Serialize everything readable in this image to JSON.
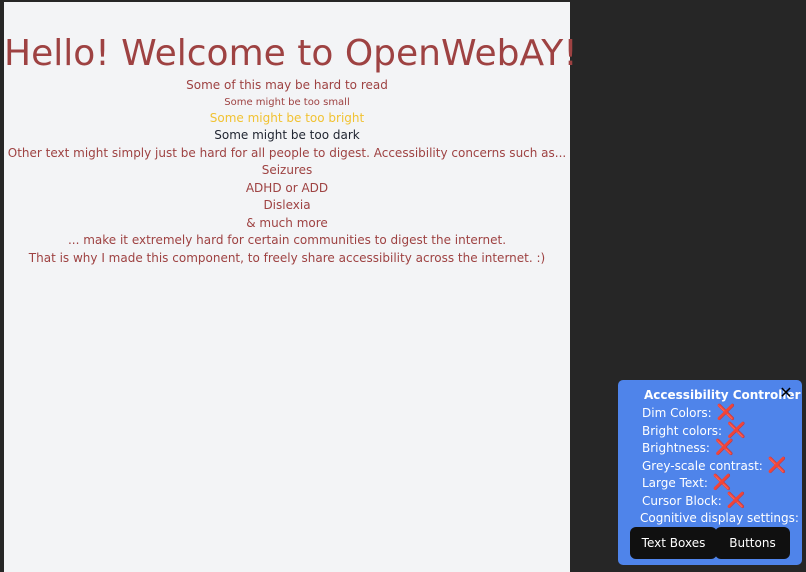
{
  "main": {
    "title": "Hello! Welcome to OpenWebAY!",
    "lines": [
      "Some of this may be hard to read",
      "Some might be too small",
      "Some might be too bright",
      "Some might be too dark",
      "Other text might simply just be hard for all people to digest. Accessibility concerns such as...",
      "Seizures",
      "ADHD or ADD",
      "Dislexia",
      "& much more",
      "... make it extremely hard for certain communities to digest the internet.",
      "That is why I made this component, to freely share accessibility across the internet. :)"
    ]
  },
  "controller": {
    "title": "Accessibility Controller",
    "close_glyph": "✕",
    "options": [
      {
        "label": "Dim Colors:",
        "state_icon": "cross-icon",
        "glyph": "❌"
      },
      {
        "label": "Bright colors:",
        "state_icon": "cross-icon",
        "glyph": "❌"
      },
      {
        "label": "Brightness:",
        "state_icon": "cross-icon",
        "glyph": "❌"
      },
      {
        "label": "Grey-scale contrast:",
        "state_icon": "cross-icon",
        "glyph": "❌"
      },
      {
        "label": "Large Text:",
        "state_icon": "cross-icon",
        "glyph": "❌"
      },
      {
        "label": "Cursor Block:",
        "state_icon": "cross-icon",
        "glyph": "❌"
      }
    ],
    "cognitive_label": "Cognitive display settings:",
    "buttons": {
      "text_boxes": "Text Boxes",
      "buttons": "Buttons"
    }
  },
  "colors": {
    "page_background": "#f3f4f6",
    "text_red": "#9e4242",
    "text_bright": "#f1c232",
    "text_dark": "#1f2430",
    "panel_blue": "#4f84ea",
    "button_black": "#101010",
    "outer_background": "#262626"
  }
}
